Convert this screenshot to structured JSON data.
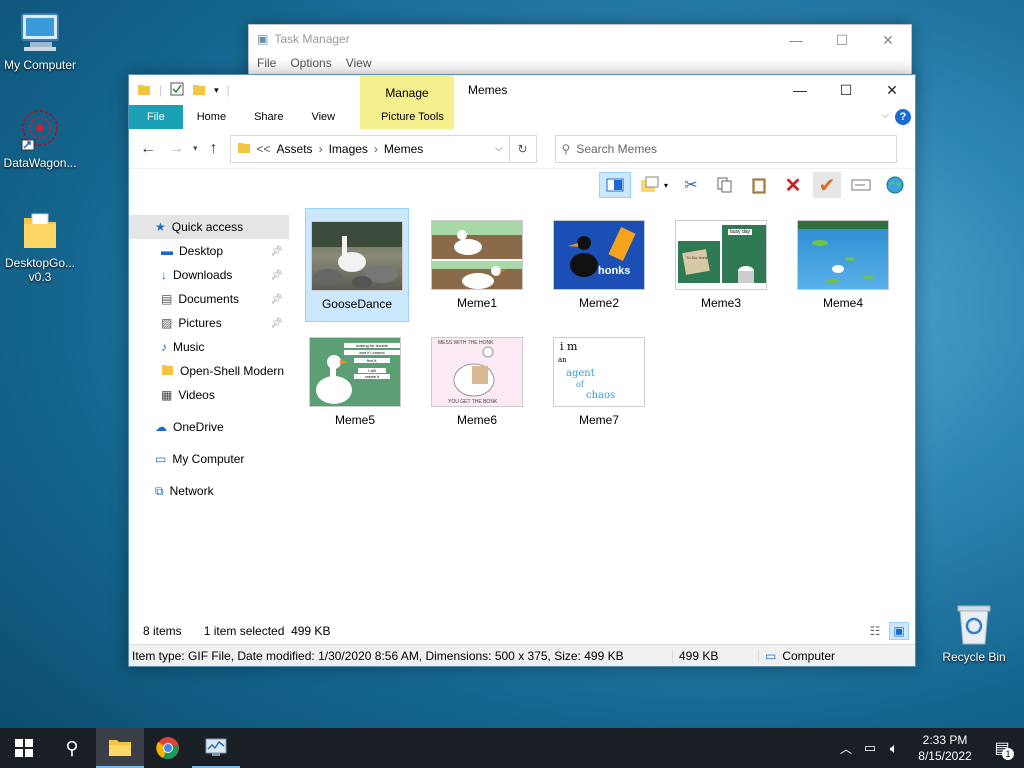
{
  "desktop": {
    "icons": [
      {
        "label": "My Computer",
        "icon": "computer-icon"
      },
      {
        "label": "DataWagon...",
        "icon": "datawagon-icon"
      },
      {
        "label": "DesktopGo... v0.3",
        "icon": "folder-icon"
      },
      {
        "label": "Recycle Bin",
        "icon": "recycle-bin-icon"
      }
    ]
  },
  "task_manager": {
    "title": "Task Manager",
    "menu": [
      "File",
      "Options",
      "View"
    ]
  },
  "explorer": {
    "title": "Memes",
    "contextual_group": "Manage",
    "tabs": [
      "File",
      "Home",
      "Share",
      "View",
      "Picture Tools"
    ],
    "breadcrumb": {
      "prefix": "<<",
      "parts": [
        "Assets",
        "Images",
        "Memes"
      ]
    },
    "search": {
      "placeholder": "Search Memes"
    },
    "nav": {
      "quick_access": "Quick access",
      "items": [
        {
          "label": "Desktop",
          "icon": "desktop-icon",
          "pinned": true
        },
        {
          "label": "Downloads",
          "icon": "downloads-icon",
          "pinned": true
        },
        {
          "label": "Documents",
          "icon": "documents-icon",
          "pinned": true
        },
        {
          "label": "Pictures",
          "icon": "pictures-icon",
          "pinned": true
        },
        {
          "label": "Music",
          "icon": "music-icon",
          "pinned": false
        },
        {
          "label": "Open-Shell Modern",
          "icon": "folder-icon",
          "pinned": false
        },
        {
          "label": "Videos",
          "icon": "videos-icon",
          "pinned": false
        }
      ],
      "onedrive": "OneDrive",
      "my_computer": "My Computer",
      "network": "Network"
    },
    "files": [
      {
        "name": "GooseDance",
        "selected": true
      },
      {
        "name": "Meme1",
        "selected": false
      },
      {
        "name": "Meme2",
        "selected": false
      },
      {
        "name": "Meme3",
        "selected": false
      },
      {
        "name": "Meme4",
        "selected": false
      },
      {
        "name": "Meme5",
        "selected": false
      },
      {
        "name": "Meme6",
        "selected": false
      },
      {
        "name": "Meme7",
        "selected": false
      }
    ],
    "thumb_text": {
      "meme2": "honks",
      "meme3": "busy day",
      "meme3_note": "To Do: honk",
      "meme5_lines": [
        "looking for trouble",
        "and if I cannot",
        "find it,",
        "I will",
        "create it"
      ],
      "meme6_top": "MESS WITH THE HONK",
      "meme6_bottom": "YOU GET THE BONK",
      "meme7": [
        "i m",
        "an",
        "agent",
        "of",
        "chaos"
      ]
    },
    "status": {
      "count": "8 items",
      "selection": "1 item selected",
      "size": "499 KB",
      "detail": "Item type: GIF File, Date modified: 1/30/2020 8:56 AM, Dimensions: 500 x 375, Size: 499 KB",
      "detail_size": "499 KB",
      "location": "Computer"
    }
  },
  "taskbar": {
    "time": "2:33 PM",
    "date": "8/15/2022",
    "notification_count": "1"
  },
  "colors": {
    "selection": "#cce8ff",
    "selection_border": "#99d1ff",
    "manage_tab": "#f5ef8e",
    "file_tab": "#19a0b5",
    "taskbar": "#1a1f26",
    "delete_red": "#d21d1d",
    "check_orange": "#e06b1f"
  }
}
